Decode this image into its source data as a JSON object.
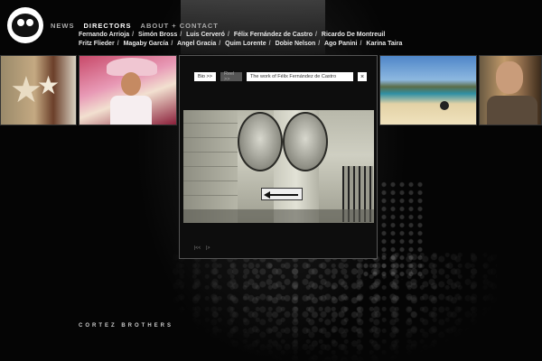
{
  "nav": {
    "items": [
      {
        "label": "NEWS",
        "active": false
      },
      {
        "label": "DIRECTORS",
        "active": true
      },
      {
        "label": "ABOUT + CONTACT",
        "active": false
      }
    ]
  },
  "directors": [
    "Fernando Arrioja",
    "Simón Bross",
    "Luis Cerveró",
    "Félix Fernández de Castro",
    "Ricardo De Montreuil",
    "Fritz Flieder",
    "Magaby García",
    "Angel Gracia",
    "Quim Lorente",
    "Dobie Nelson",
    "Ago Panini",
    "Karina Taira"
  ],
  "player": {
    "bio_label": "Bio >>",
    "reel_label": "Reel >>",
    "title": "The  work of Félix Fernández de Castro",
    "close_label": "×",
    "prev_label": "|<<",
    "next_label": "|>"
  },
  "footer": {
    "brand": "CORTEZ BROTHERS"
  }
}
